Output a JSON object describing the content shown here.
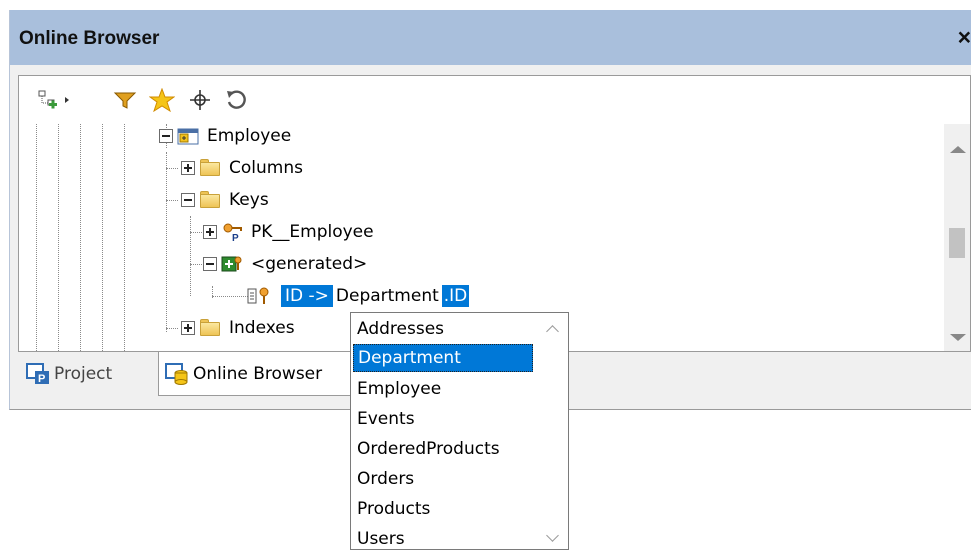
{
  "panel": {
    "title": "Online Browser",
    "close_label": "×"
  },
  "toolbar": {
    "buttons": [
      {
        "name": "add-object-icon",
        "dropdown": true
      },
      {
        "name": "filter-icon"
      },
      {
        "name": "favorites-star-icon"
      },
      {
        "name": "locate-crosshair-icon"
      },
      {
        "name": "refresh-icon"
      }
    ]
  },
  "tree": {
    "employee": "Employee",
    "columns": "Columns",
    "keys": "Keys",
    "pk": "PK__Employee",
    "generated": "<generated>",
    "fk_part1": "ID ->",
    "fk_part2": "Department",
    "fk_part3": ".ID",
    "indexes": "Indexes"
  },
  "tabs": {
    "project": "Project",
    "online": "Online Browser"
  },
  "dropdown": {
    "items": [
      "Addresses",
      "Department",
      "Employee",
      "Events",
      "OrderedProducts",
      "Orders",
      "Products",
      "Users"
    ],
    "selected": "Department"
  },
  "colors": {
    "titlebar": "#a9bfdc",
    "selection": "#0078d7"
  }
}
